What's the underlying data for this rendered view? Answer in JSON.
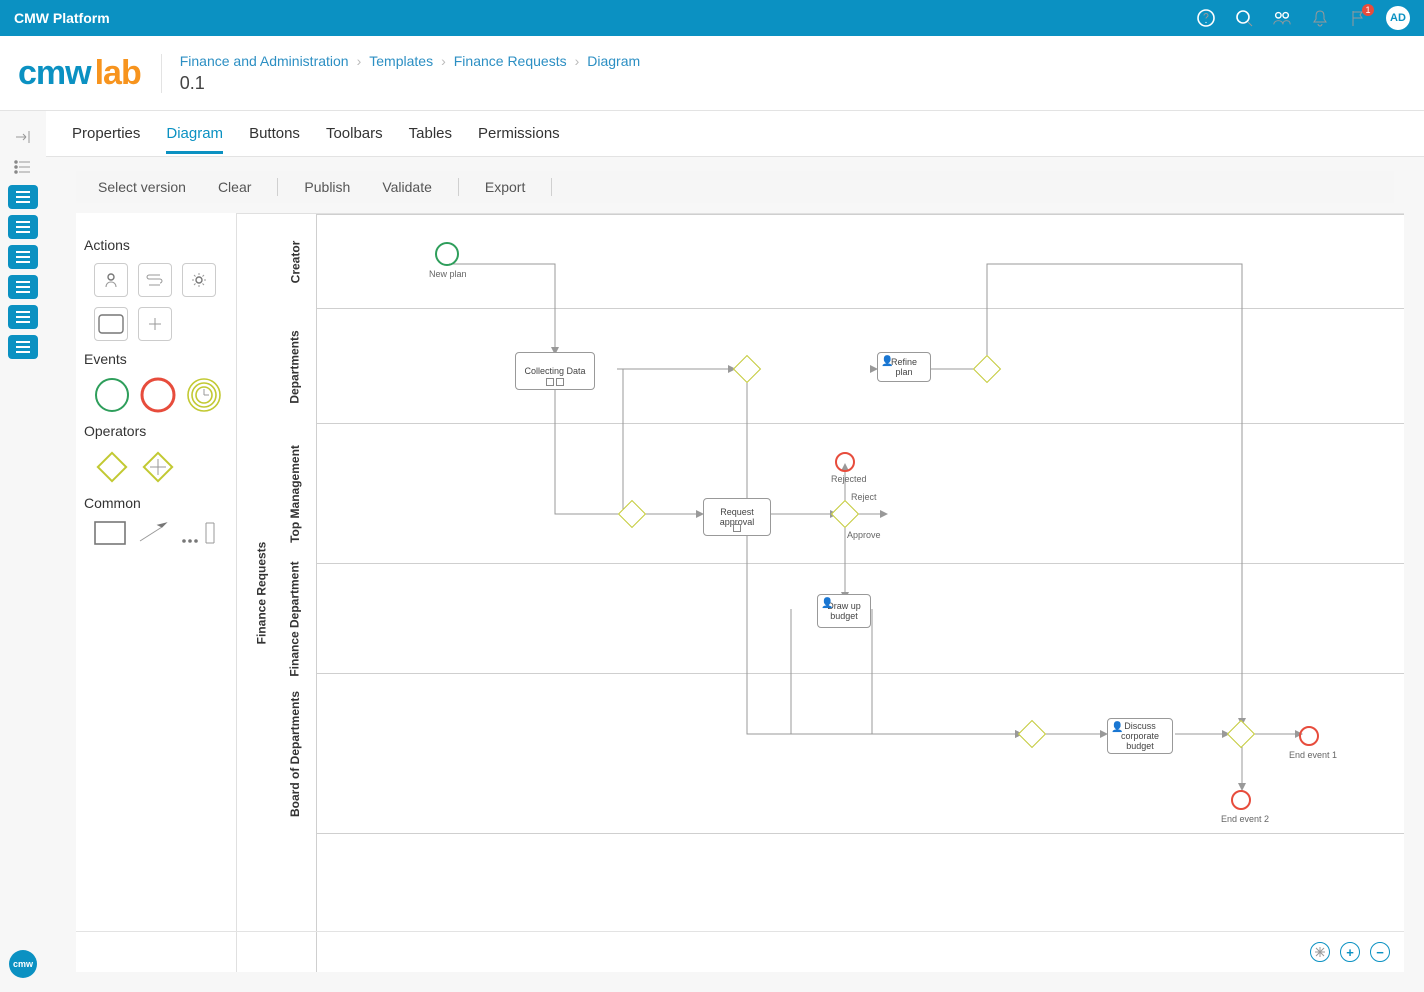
{
  "topbar": {
    "brand": "CMW Platform",
    "avatar": "AD",
    "notif_badge": "1"
  },
  "breadcrumb": {
    "items": [
      "Finance and Administration",
      "Templates",
      "Finance Requests",
      "Diagram"
    ]
  },
  "version": "0.1",
  "tabs": {
    "items": [
      "Properties",
      "Diagram",
      "Buttons",
      "Toolbars",
      "Tables",
      "Permissions"
    ],
    "active": 1
  },
  "toolbar": {
    "items": [
      "Select version",
      "Clear",
      "Publish",
      "Validate",
      "Export"
    ]
  },
  "palette": {
    "sections": {
      "actions": "Actions",
      "events": "Events",
      "operators": "Operators",
      "common": "Common"
    }
  },
  "chart_data": {
    "type": "bpmn",
    "pool": "Finance Requests",
    "lanes": [
      "Creator",
      "Departments",
      "Top Management",
      "Finance Department",
      "Board of Departments"
    ],
    "tasks": {
      "collect": "Collecting Data",
      "approval": "Request approval",
      "refine": "Refine plan",
      "drawup": "Draw up budget",
      "discuss": "Discuss corporate budget"
    },
    "events": {
      "start": "New plan",
      "rejected": "Rejected",
      "end1": "End event 1",
      "end2": "End event 2"
    },
    "gateways": {
      "gw_approve": {
        "outgoing": [
          "Reject",
          "Approve"
        ]
      }
    }
  },
  "colors": {
    "primary": "#0b91c2",
    "accent": "#f7941e",
    "start": "#2e9e5b",
    "end": "#e74c3c",
    "gateway": "#c2c932"
  }
}
